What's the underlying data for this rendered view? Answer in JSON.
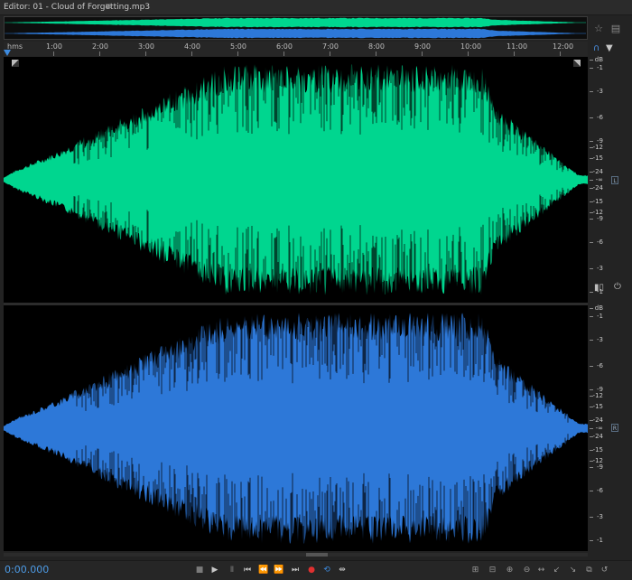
{
  "editor": {
    "title": "Editor: 01 - Cloud of Forgetting.mp3",
    "menu_icon": "hamburger-icon"
  },
  "ruler": {
    "unit": "hms",
    "labels": [
      "1:00",
      "2:00",
      "3:00",
      "4:00",
      "5:00",
      "6:00",
      "7:00",
      "8:00",
      "9:00",
      "10:00",
      "11:00",
      "12:00"
    ]
  },
  "db_scale": {
    "unit": "dB",
    "top_channel": [
      "dB",
      "-1",
      "-3",
      "-6",
      "-9",
      "-12",
      "-15",
      "-24",
      "-∞",
      "-24",
      "-15",
      "-12",
      "-9",
      "-6",
      "-3",
      "-1"
    ],
    "bottom_channel": [
      "dB",
      "-1",
      "-3",
      "-6",
      "-9",
      "-12",
      "-15",
      "-24",
      "-∞",
      "-24",
      "-15",
      "-12",
      "-9",
      "-6",
      "-3",
      "-1"
    ]
  },
  "channels": [
    {
      "tag": "L",
      "color": "#00d68f"
    },
    {
      "tag": "R",
      "color": "#2d78d8"
    }
  ],
  "transport": {
    "timecode": "0:00.000",
    "icons": [
      "stop-icon",
      "play-icon",
      "pause-icon",
      "go-to-start-icon",
      "rewind-icon",
      "fast-forward-icon",
      "go-to-end-icon",
      "record-icon",
      "loop-icon",
      "skip-selection-icon"
    ],
    "glyphs": [
      "■",
      "▶",
      "Ⅱ",
      "⏮",
      "⏪",
      "⏩",
      "⏭",
      "●",
      "⟲",
      "⇹"
    ],
    "record_color": "#e03030",
    "active_color": "#3d8be0"
  },
  "zoom": {
    "icons": [
      "zoom-in-amplitude-icon",
      "zoom-out-amplitude-icon",
      "zoom-in-time-icon",
      "zoom-out-time-icon",
      "zoom-full-icon",
      "zoom-in-left-icon",
      "zoom-in-right-icon",
      "zoom-selection-icon",
      "reset-zoom-icon"
    ],
    "glyphs": [
      "⊞",
      "⊟",
      "⊕",
      "⊖",
      "↔",
      "↙",
      "↘",
      "⧉",
      "↺"
    ]
  },
  "accent_colors": {
    "timecode": "#4d9be6",
    "waveform_top": "#00d68f",
    "waveform_bottom": "#2d78d8"
  }
}
